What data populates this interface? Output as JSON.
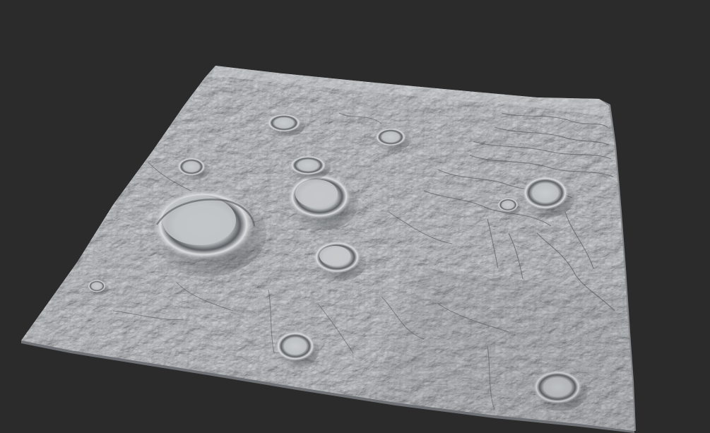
{
  "scene": {
    "background_color": "#2b2b2b",
    "terrain_base_color": "#b3b6b9",
    "terrain_light_color": "#d2d4d6",
    "terrain_shadow_color": "#4a4d51",
    "subject": "terrain-heightmap",
    "crater_count": 12
  }
}
